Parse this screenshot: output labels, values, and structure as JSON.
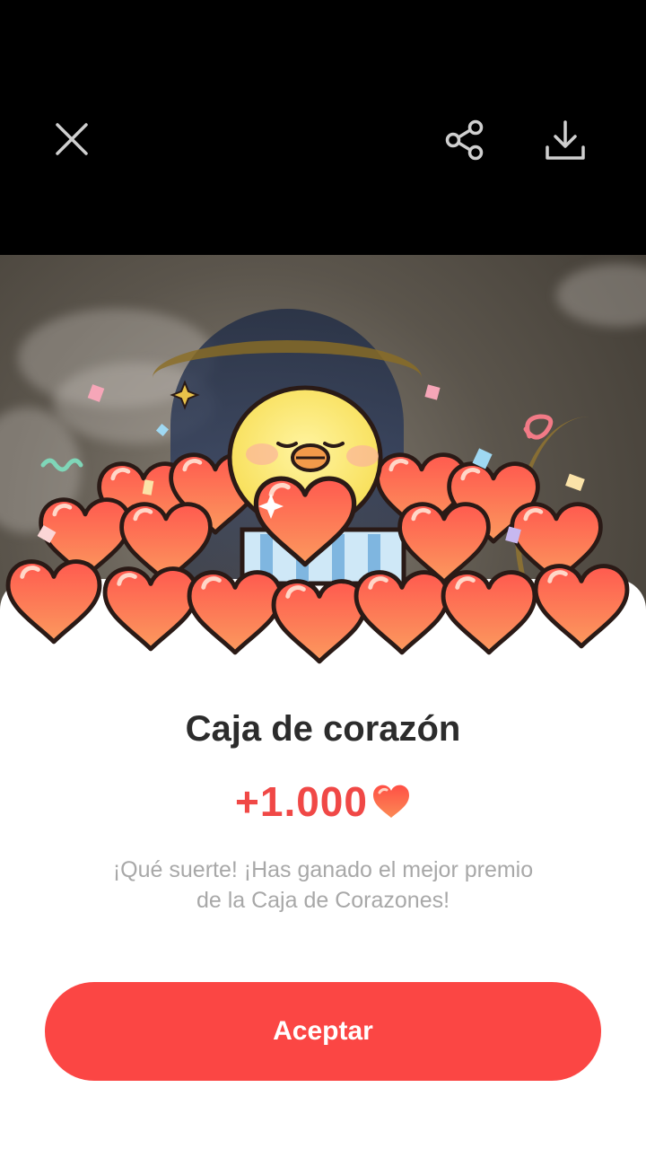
{
  "toolbar": {
    "close_icon": "close-icon",
    "share_icon": "share-icon",
    "download_icon": "download-icon"
  },
  "dialog": {
    "title": "Caja de corazón",
    "reward_amount": "+1.000",
    "reward_icon": "heart-icon",
    "description": "¡Qué suerte! ¡Has ganado el mejor premio de la Caja de Corazones!",
    "accept_label": "Aceptar"
  },
  "colors": {
    "accent": "#fb4644",
    "amount": "#f04846",
    "heart": "#f2694a",
    "chick": "#fbe86a"
  }
}
